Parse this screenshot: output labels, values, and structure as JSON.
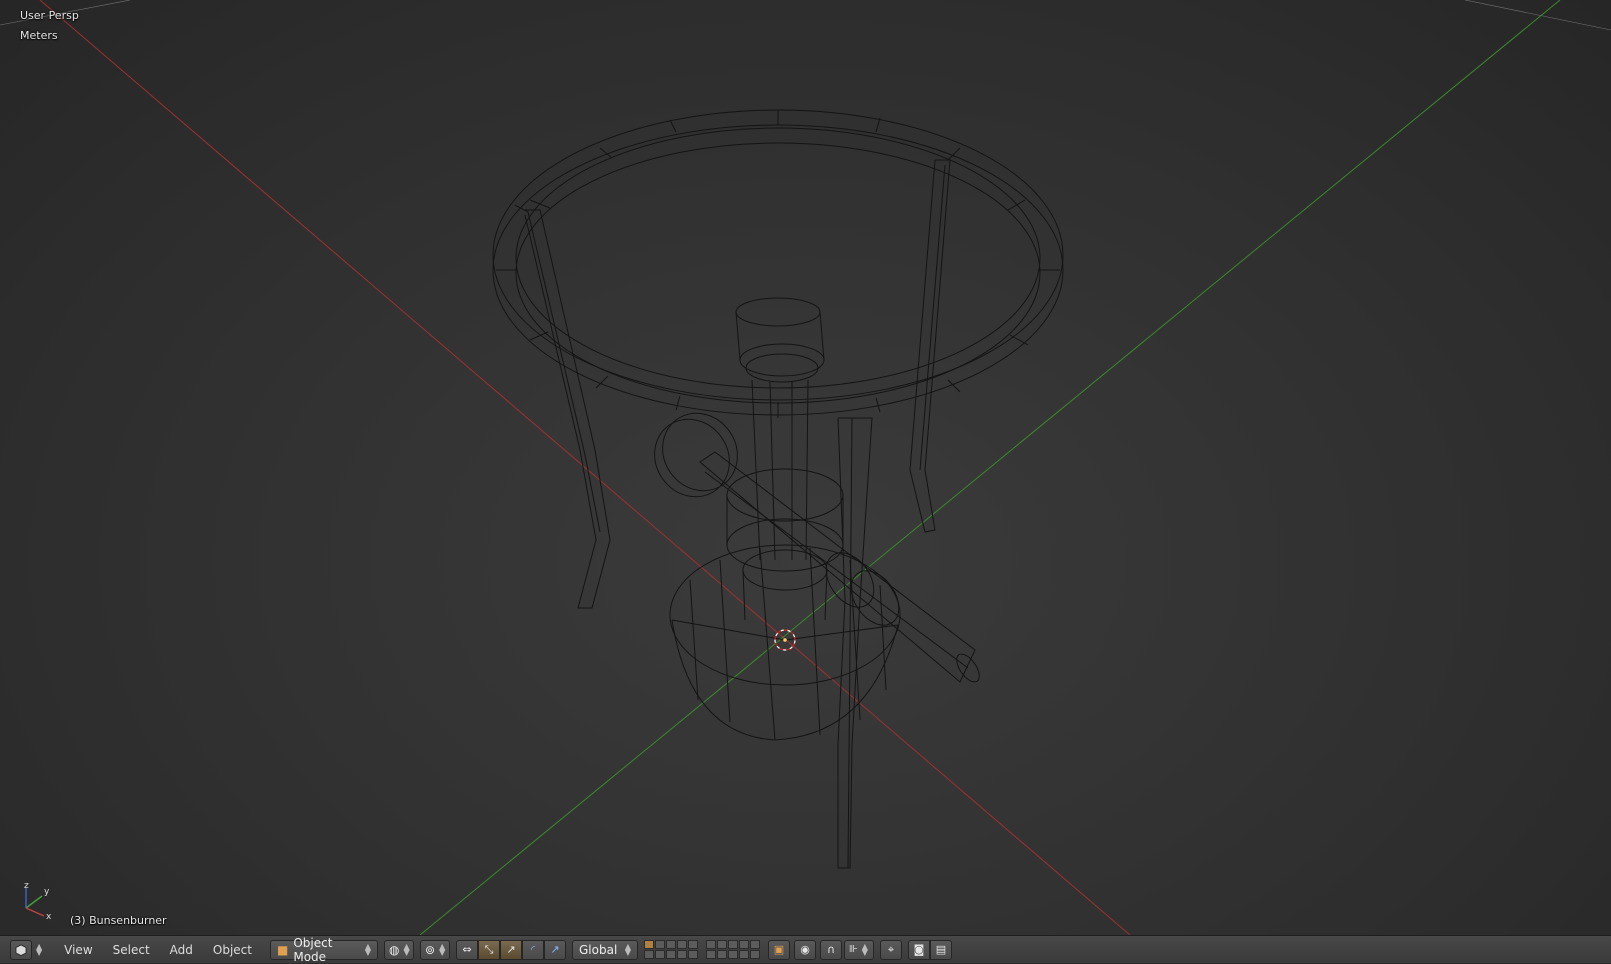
{
  "viewport": {
    "view_name": "User Persp",
    "units": "Meters",
    "object_name": "(3) Bunsenburner",
    "axis_gizmo_labels": {
      "x": "x",
      "y": "y",
      "z": "z"
    }
  },
  "header": {
    "editor_type_icon": "cube-editor-icon",
    "menus": [
      "View",
      "Select",
      "Add",
      "Object"
    ],
    "mode": "Object Mode",
    "shading_icon": "sphere-shading-icon",
    "pivot_icon": "pivot-point-icon",
    "manipulator_icon": "manipulator-icon",
    "transform_orientation": "Global",
    "snap_icon": "magnet-icon",
    "proportional_icon": "proportional-edit-icon",
    "render_icon": "camera-render-icon",
    "anim_render_icon": "clapperboard-icon"
  },
  "colors": {
    "background": "#2b2b2b",
    "wire": "#151515",
    "x_axis": "#a03030",
    "y_axis": "#3a8a2a",
    "header": "#3f3f3f",
    "accent": "#b08040"
  }
}
